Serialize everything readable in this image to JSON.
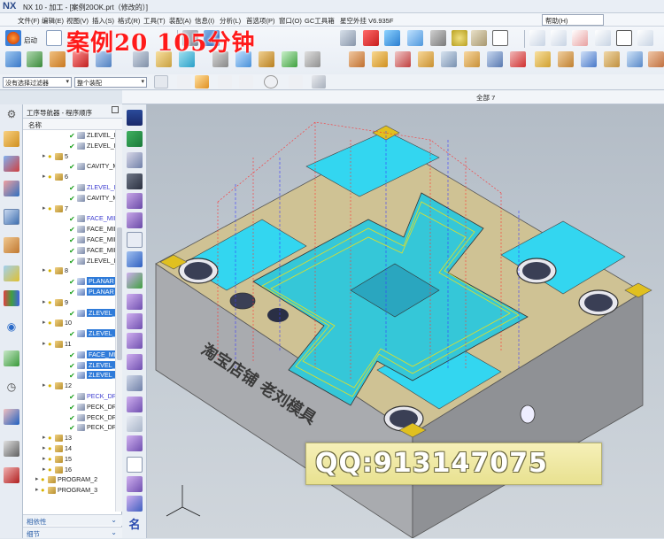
{
  "window": {
    "logo": "NX",
    "title": "NX 10 - 加工 - [案例20OK.prt（修改的）]"
  },
  "menu": {
    "items": [
      "文件(F)",
      "编辑(E)",
      "视图(V)",
      "插入(S)",
      "格式(R)",
      "工具(T)",
      "装配(A)",
      "信息(I)",
      "分析(L)",
      "首选项(P)",
      "窗口(O)",
      "GC工具箱",
      "星空外挂 V6.935F"
    ],
    "help": "帮助(H)"
  },
  "toolbar": {
    "start_label": "启动"
  },
  "watermark": {
    "text": "案例20  105分钟"
  },
  "filter": {
    "selection_filter": "没有选择过滤器",
    "assembly_scope": "整个装配"
  },
  "viewport": {
    "label": "全部 7"
  },
  "navigator": {
    "title": "工序导航器 - 程序顺序",
    "column": "名称",
    "rows": [
      {
        "indent": 2,
        "check": true,
        "text": "ZLEVEL_PRO"
      },
      {
        "indent": 2,
        "check": true,
        "text": "ZLEVEL_PRO"
      },
      {
        "indent": 1,
        "group": true,
        "text": "5"
      },
      {
        "indent": 2,
        "check": true,
        "text": "CAVITY_MILL"
      },
      {
        "indent": 1,
        "group": true,
        "text": "6"
      },
      {
        "indent": 2,
        "check": true,
        "text": "ZLEVEL_PRO",
        "blue": true
      },
      {
        "indent": 2,
        "check": true,
        "text": "CAVITY_MILL"
      },
      {
        "indent": 1,
        "group": true,
        "text": "7"
      },
      {
        "indent": 2,
        "check": true,
        "text": "FACE_MILLIN",
        "blue": true
      },
      {
        "indent": 2,
        "check": true,
        "text": "FACE_MILLIN"
      },
      {
        "indent": 2,
        "check": true,
        "text": "FACE_MILLIN"
      },
      {
        "indent": 2,
        "check": true,
        "text": "FACE_MILLIN"
      },
      {
        "indent": 2,
        "check": true,
        "text": "ZLEVEL_PRO"
      },
      {
        "indent": 1,
        "group": true,
        "text": "8"
      },
      {
        "indent": 2,
        "check": true,
        "text": "PLANAR_MIL",
        "selected": true
      },
      {
        "indent": 2,
        "check": true,
        "text": "PLANAR_MIL",
        "selected": true
      },
      {
        "indent": 1,
        "group": true,
        "text": "9"
      },
      {
        "indent": 2,
        "check": true,
        "text": "ZLEVEL_PRO",
        "selected": true
      },
      {
        "indent": 1,
        "group": true,
        "text": "10"
      },
      {
        "indent": 2,
        "check": true,
        "text": "ZLEVEL_PRO",
        "selected": true
      },
      {
        "indent": 1,
        "group": true,
        "text": "11"
      },
      {
        "indent": 2,
        "check": true,
        "text": "FACE_MILLIN",
        "selected": true
      },
      {
        "indent": 2,
        "check": true,
        "text": "ZLEVEL_PRO",
        "selected": true
      },
      {
        "indent": 2,
        "check": true,
        "text": "ZLEVEL_PRO",
        "selected": true
      },
      {
        "indent": 1,
        "group": true,
        "text": "12"
      },
      {
        "indent": 2,
        "check": true,
        "text": "PECK_DRILLI",
        "blue": true
      },
      {
        "indent": 2,
        "check": true,
        "text": "PECK_DRILLI"
      },
      {
        "indent": 2,
        "check": true,
        "text": "PECK_DRILLI"
      },
      {
        "indent": 2,
        "check": true,
        "text": "PECK_DRILLI"
      },
      {
        "indent": 1,
        "group": true,
        "text": "13"
      },
      {
        "indent": 1,
        "group": true,
        "text": "14"
      },
      {
        "indent": 1,
        "group": true,
        "text": "15"
      },
      {
        "indent": 1,
        "group": true,
        "text": "16"
      },
      {
        "indent": 0,
        "group": true,
        "text": "PROGRAM_2"
      },
      {
        "indent": 0,
        "group": true,
        "text": "PROGRAM_3"
      }
    ],
    "sections": [
      "相依性",
      "细节"
    ]
  },
  "model": {
    "engraving": "淘宝店铺 老刘模具"
  },
  "overlay": {
    "qq": "QQ:913147075"
  },
  "colors": {
    "cyan": "#33d6f0",
    "tan": "#d9c690",
    "gray": "#b4b4b4",
    "gold": "#e0c020",
    "toolpath": "#ff3030",
    "toolpath_blue": "#3a3aff"
  }
}
